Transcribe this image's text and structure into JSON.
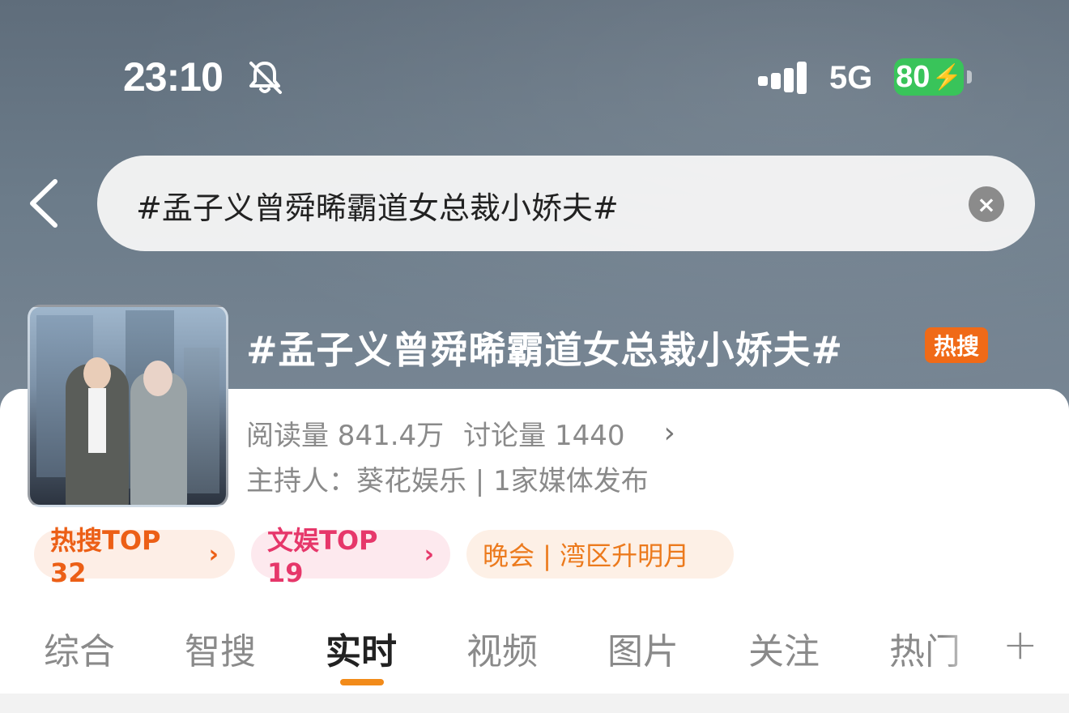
{
  "status_bar": {
    "time": "23:10",
    "silent_icon": "bell-slash-icon",
    "signal_icon": "signal-bars-icon",
    "network": "5G",
    "battery": "80",
    "battery_color": "#39c45a"
  },
  "search": {
    "query": "#孟子义曾舜晞霸道女总裁小娇夫#",
    "clear_icon": "clear-icon",
    "back_icon": "chevron-left-icon"
  },
  "topic": {
    "title": "#孟子义曾舜晞霸道女总裁小娇夫#",
    "hot_badge": "热搜",
    "read_count": "阅读量 841.4万",
    "discuss_count": "讨论量 1440",
    "host_line": "主持人：葵花娱乐 | 1家媒体发布"
  },
  "pills": [
    {
      "label": "热搜TOP 32",
      "color": "#ec5f16"
    },
    {
      "label": "文娱TOP 19",
      "color": "#e6376a"
    },
    {
      "label": "晚会 | 湾区升明月",
      "color": "#ec7a1d"
    }
  ],
  "tabs": [
    {
      "label": "综合"
    },
    {
      "label": "智搜"
    },
    {
      "label": "实时",
      "active": true
    },
    {
      "label": "视频"
    },
    {
      "label": "图片"
    },
    {
      "label": "关注"
    },
    {
      "label": "热门"
    }
  ],
  "accent_color": "#f28b1a"
}
